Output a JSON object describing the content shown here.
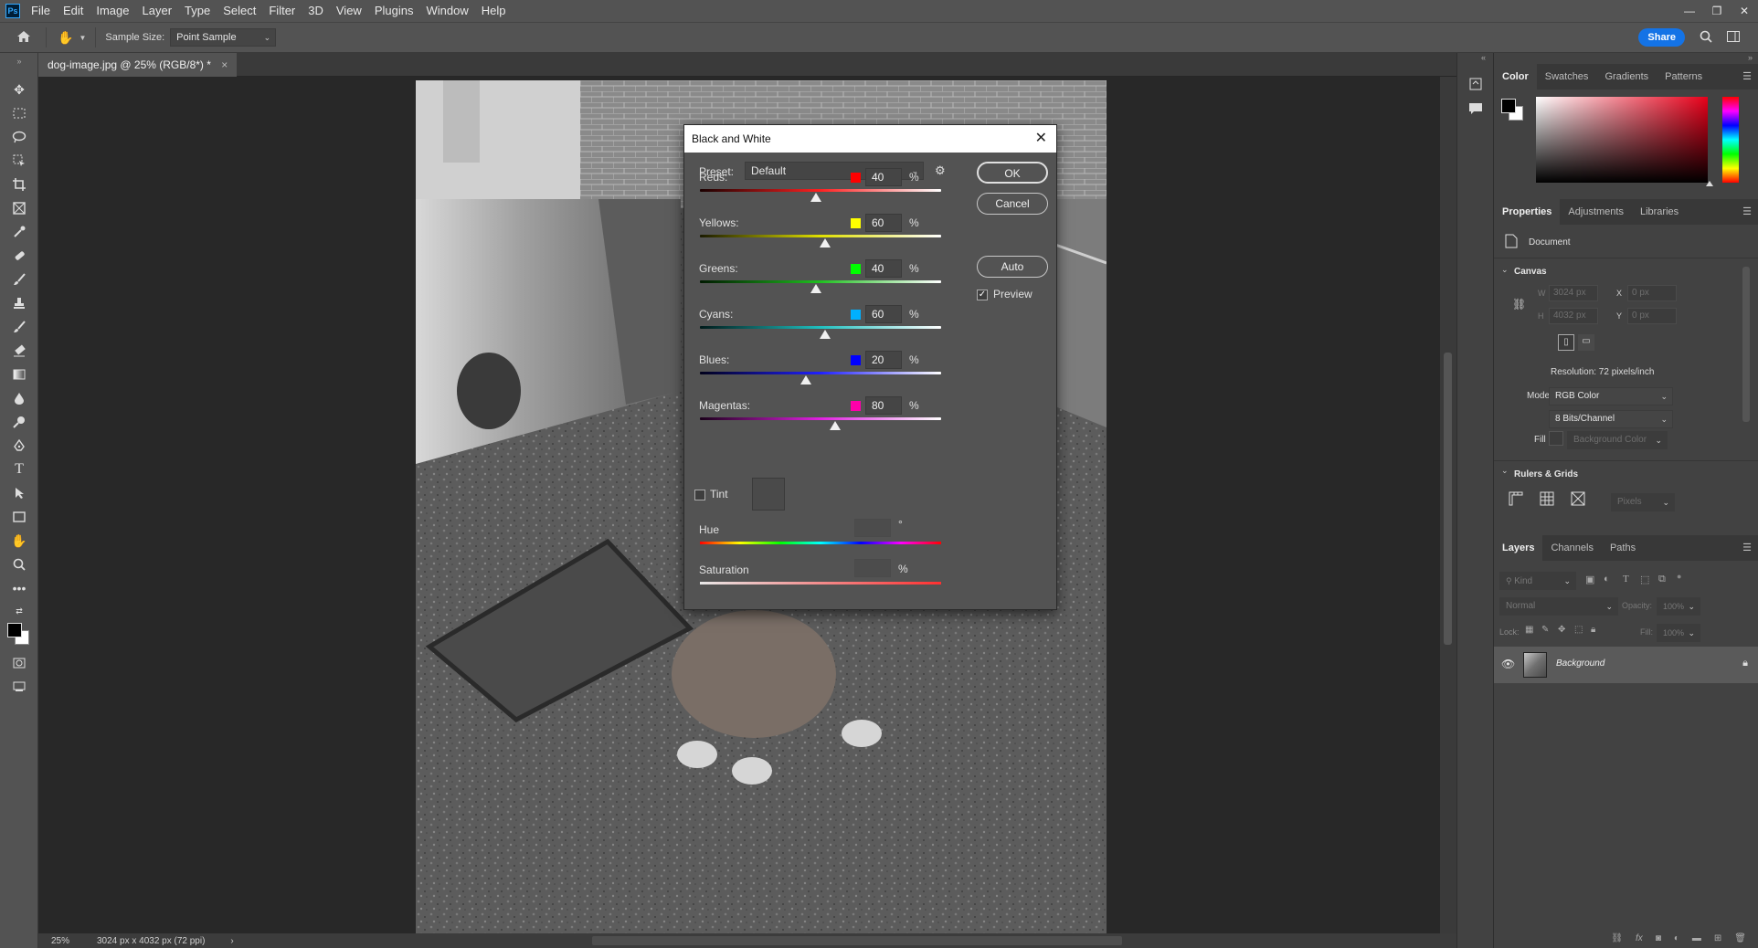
{
  "app": {
    "logo": "Ps"
  },
  "menu": [
    "File",
    "Edit",
    "Image",
    "Layer",
    "Type",
    "Select",
    "Filter",
    "3D",
    "View",
    "Plugins",
    "Window",
    "Help"
  ],
  "window_controls": {
    "minimize": "—",
    "restore": "❐",
    "close": "✕"
  },
  "options": {
    "sample_size_label": "Sample Size:",
    "sample_size_value": "Point Sample",
    "share": "Share"
  },
  "document": {
    "tab_title": "dog-image.jpg @ 25% (RGB/8*) *",
    "tab_close": "×"
  },
  "status": {
    "zoom": "25%",
    "info": "3024 px x 4032 px (72 ppi)",
    "arrow": "›"
  },
  "dialog": {
    "title": "Black and White",
    "preset_label": "Preset:",
    "preset_value": "Default",
    "ok": "OK",
    "cancel": "Cancel",
    "auto": "Auto",
    "preview": "Preview",
    "sliders": [
      {
        "label": "Reds:",
        "value": "40",
        "color": "#ff0000",
        "unit": "%",
        "gradient": "linear-gradient(to right,#1a0000,#ff2020,#ffffff)",
        "fraction": 0.48
      },
      {
        "label": "Yellows:",
        "value": "60",
        "color": "#ffff00",
        "unit": "%",
        "gradient": "linear-gradient(to right,#1a1a00,#e0e000,#ffffff)",
        "fraction": 0.52
      },
      {
        "label": "Greens:",
        "value": "40",
        "color": "#00ff00",
        "unit": "%",
        "gradient": "linear-gradient(to right,#001a00,#20c020,#ffffff)",
        "fraction": 0.48
      },
      {
        "label": "Cyans:",
        "value": "60",
        "color": "#00b0ff",
        "unit": "%",
        "gradient": "linear-gradient(to right,#001a1a,#20c0c0,#ffffff)",
        "fraction": 0.52
      },
      {
        "label": "Blues:",
        "value": "20",
        "color": "#0000ff",
        "unit": "%",
        "gradient": "linear-gradient(to right,#00001a,#2020ff,#ffffff)",
        "fraction": 0.44
      },
      {
        "label": "Magentas:",
        "value": "80",
        "color": "#ff00aa",
        "unit": "%",
        "gradient": "linear-gradient(to right,#1a001a,#e020e0,#ffffff)",
        "fraction": 0.56
      }
    ],
    "tint": "Tint",
    "hue": "Hue",
    "hue_unit": "°",
    "saturation": "Saturation",
    "saturation_unit": "%"
  },
  "panels": {
    "color_tabs": [
      "Color",
      "Swatches",
      "Gradients",
      "Patterns"
    ],
    "props_tabs": [
      "Properties",
      "Adjustments",
      "Libraries"
    ],
    "document_label": "Document",
    "canvas_header": "Canvas",
    "w_label": "W",
    "w_value": "3024 px",
    "h_label": "H",
    "h_value": "4032 px",
    "x_label": "X",
    "x_value": "0 px",
    "y_label": "Y",
    "y_value": "0 px",
    "resolution": "Resolution: 72 pixels/inch",
    "mode_label": "Mode",
    "mode_value": "RGB Color",
    "bits_value": "8 Bits/Channel",
    "fill_label": "Fill",
    "fill_value": "Background Color",
    "rulers_header": "Rulers & Grids",
    "units_value": "Pixels",
    "layers_tabs": [
      "Layers",
      "Channels",
      "Paths"
    ],
    "kind_placeholder": "Kind",
    "blend_mode": "Normal",
    "opacity_label": "Opacity:",
    "opacity_value": "100%",
    "lock_label": "Lock:",
    "fill2_label": "Fill:",
    "fill2_value": "100%",
    "layer_name": "Background"
  }
}
